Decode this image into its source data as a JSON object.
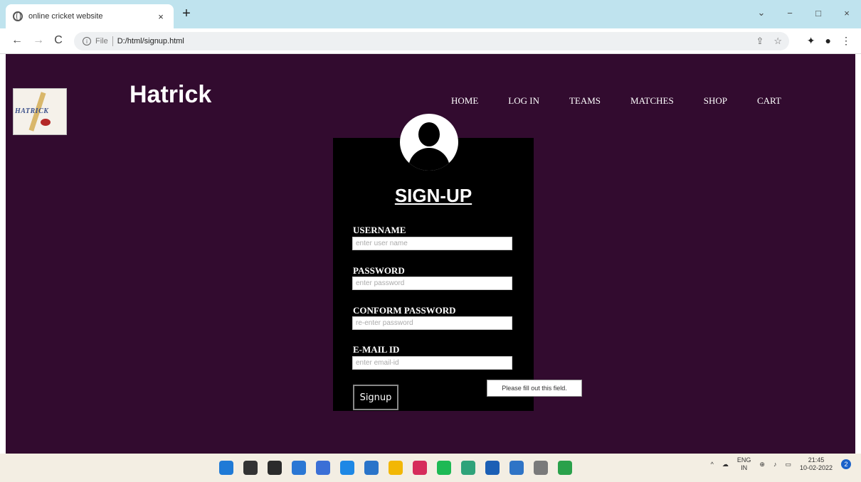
{
  "browser": {
    "tab_title": "online cricket website",
    "tab_close": "×",
    "new_tab": "+",
    "window_controls": [
      "⌄",
      "−",
      "□",
      "×"
    ],
    "nav": {
      "back": "←",
      "forward": "→",
      "reload": "C"
    },
    "address": {
      "scheme_label": "File",
      "url": "D:/html/signup.html"
    }
  },
  "site": {
    "brand": "Hatrick",
    "logo_text": "HATRICK",
    "nav": [
      "HOME",
      "LOG IN",
      "TEAMS",
      "MATCHES",
      "SHOP",
      "CART"
    ]
  },
  "form": {
    "title": "SIGN-UP",
    "fields": [
      {
        "label": "USERNAME",
        "placeholder": "enter user name"
      },
      {
        "label": "PASSWORD",
        "placeholder": "enter password"
      },
      {
        "label": "CONFORM PASSWORD",
        "placeholder": "re-enter password"
      },
      {
        "label": "E-MAIL ID",
        "placeholder": "enter email-id"
      }
    ],
    "submit_label": "Signup",
    "validation_tooltip": "Please fill out this field."
  },
  "taskbar": {
    "lang": "ENG",
    "region": "IN",
    "time": "21:45",
    "date": "10-02-2022",
    "notification_count": "2",
    "app_icon_colors": [
      "#1f7ad6",
      "#333333",
      "#2b2b2b",
      "#2a77d4",
      "#3b6fd6",
      "#1e88e5",
      "#2a74c9",
      "#f2b705",
      "#d62c5b",
      "#1db954",
      "#2fa37a",
      "#1b5fb5",
      "#2f74c6",
      "#7a7a7a",
      "#2aa14b"
    ]
  },
  "colors": {
    "page_bg": "#320b2f",
    "card_bg": "#000000",
    "chrome_bg": "#bfe3ee"
  }
}
